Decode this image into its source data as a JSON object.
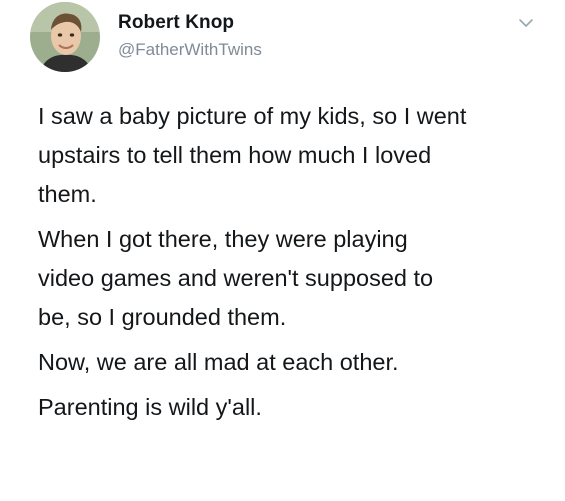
{
  "tweet": {
    "author": {
      "display_name": "Robert Knop",
      "handle": "@FatherWithTwins",
      "avatar_icon": "user-avatar-photo"
    },
    "menu_icon": "chevron-down-icon",
    "paragraphs": [
      "I saw a baby picture of my kids, so I went\nupstairs to tell them how much I loved\nthem.",
      "When I got there, they were playing\nvideo games and weren't supposed to\nbe, so I grounded them.",
      "Now, we are all mad at each other.",
      "Parenting is wild y'all."
    ]
  },
  "colors": {
    "text": "#14171a",
    "secondary_text": "#7f8b96",
    "background": "#ffffff"
  }
}
